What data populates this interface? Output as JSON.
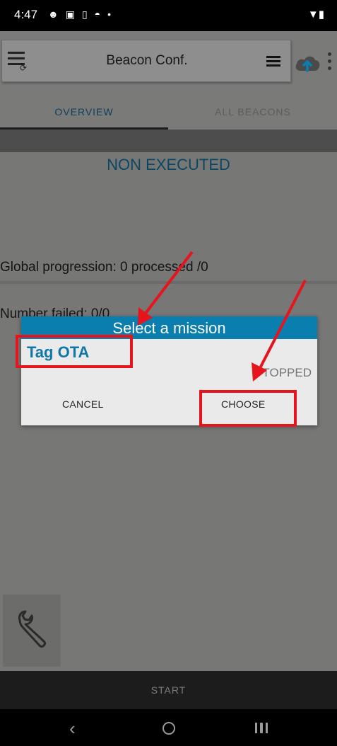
{
  "status_bar": {
    "time": "4:47",
    "notification_icons": [
      "gmail-icon",
      "privacy-icon",
      "device-icon",
      "android-icon",
      "dot-icon"
    ],
    "right_icons": [
      "wifi-icon",
      "battery-icon"
    ]
  },
  "toolbar": {
    "title": "Beacon Conf.",
    "icons": [
      "menu-icon",
      "list-icon",
      "cloud-upload-icon",
      "overflow-icon"
    ]
  },
  "tabs": [
    {
      "label": "OVERVIEW",
      "active": true
    },
    {
      "label": "ALL BEACONS",
      "active": false
    }
  ],
  "overview": {
    "status_title": "NON EXECUTED",
    "progress_text": "Global progression: 0 processed /0",
    "failed_text": "Number failed: 0/0"
  },
  "dialog": {
    "title": "Select a mission",
    "mission": "Tag OTA",
    "behind_text": "TOPPED",
    "cancel_label": "CANCEL",
    "choose_label": "CHOOSE"
  },
  "bottom": {
    "start_label": "START"
  },
  "colors": {
    "accent": "#0a7faf",
    "annotation": "#e6141c"
  }
}
